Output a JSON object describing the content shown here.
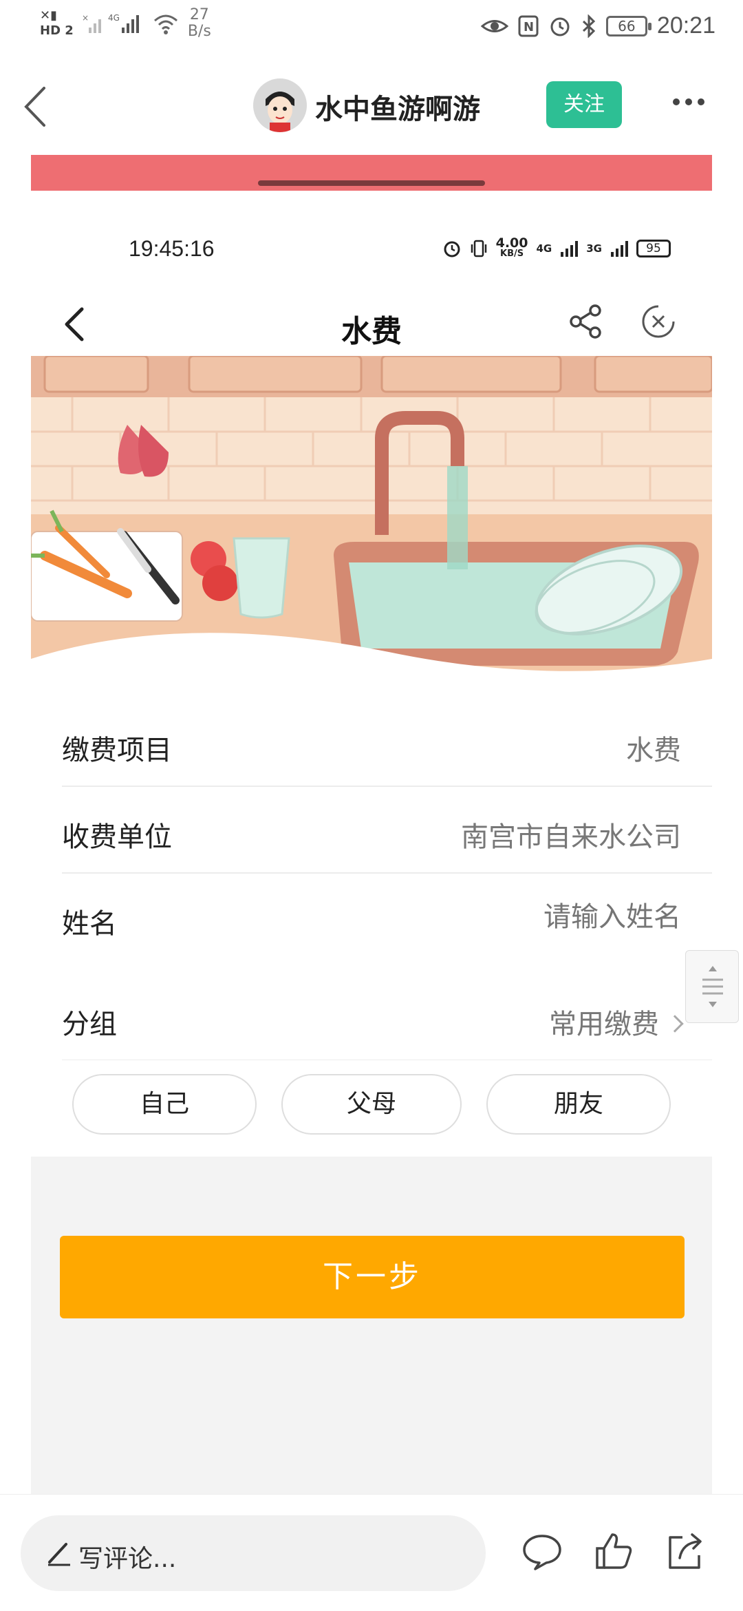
{
  "status_bar": {
    "net_speed_value": "27",
    "net_speed_unit": "B/s",
    "hd_label": "HD",
    "sim_index": "2",
    "network": "4G",
    "battery": "66",
    "time": "20:21"
  },
  "header": {
    "author_name": "水中鱼游啊游",
    "follow_label": "关注"
  },
  "inner_status_bar": {
    "time": "19:45:16",
    "speed_value": "4.00",
    "speed_unit": "KB/S",
    "network_1": "4G",
    "network_2": "3G",
    "battery": "95"
  },
  "inner_nav": {
    "title": "水费"
  },
  "form": {
    "rows": [
      {
        "label": "缴费项目",
        "value": "水费"
      },
      {
        "label": "收费单位",
        "value": "南宫市自来水公司"
      },
      {
        "label": "姓名",
        "placeholder": "请输入姓名"
      },
      {
        "label": "分组",
        "value": "常用缴费"
      }
    ],
    "chips": [
      "自己",
      "父母",
      "朋友"
    ],
    "next_label": "下一步"
  },
  "bottom_bar": {
    "comment_placeholder": "写评论..."
  },
  "colors": {
    "accent_orange": "#ffa800",
    "follow_green": "#2dbf94",
    "top_strip": "#ee6e72"
  }
}
